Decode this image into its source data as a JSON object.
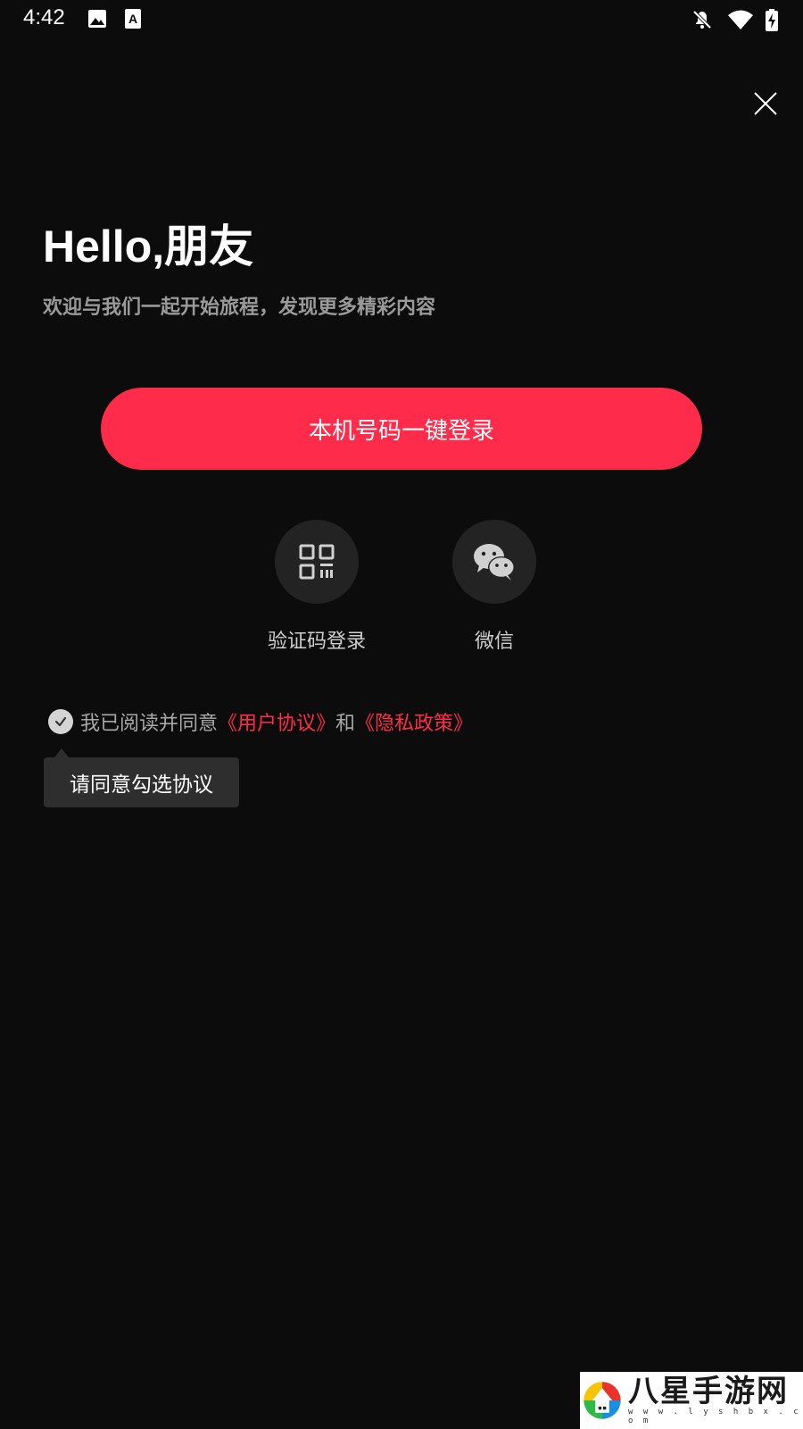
{
  "status_bar": {
    "time": "4:42",
    "icons": [
      "image-icon",
      "text-a-icon",
      "notifications-off-icon",
      "wifi-icon",
      "battery-charging-icon"
    ]
  },
  "close_icon": "close-icon",
  "greeting": "Hello,朋友",
  "subtitle": "欢迎与我们一起开始旅程，发现更多精彩内容",
  "primary_button": {
    "label": "本机号码一键登录",
    "color": "#fe2c4a"
  },
  "alt_logins": [
    {
      "label": "验证码登录",
      "icon": "qr-code-icon"
    },
    {
      "label": "微信",
      "icon": "wechat-icon"
    }
  ],
  "agreement": {
    "prefix": "我已阅读并同意",
    "user_agreement": "《用户协议》",
    "and": "和",
    "privacy_policy": "《隐私政策》"
  },
  "tooltip": "请同意勾选协议",
  "watermark": {
    "text": "八星手游网",
    "url": "w w w . l y s h b x . c o m"
  }
}
